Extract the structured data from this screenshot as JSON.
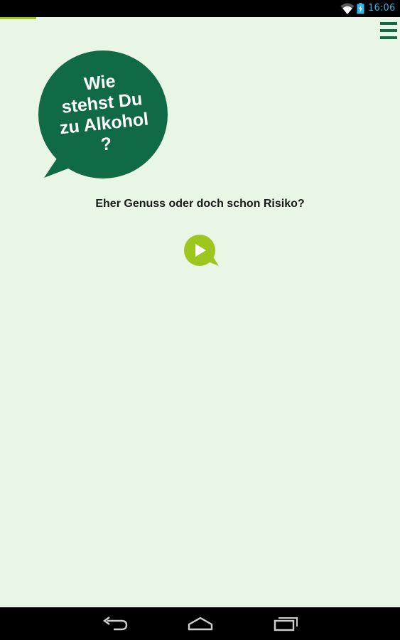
{
  "status_bar": {
    "time": "16:06",
    "icons": [
      "wifi-icon",
      "battery-charging-icon"
    ]
  },
  "progress": {
    "fraction": 0.09,
    "color": "#9dc61f"
  },
  "header": {
    "menu_icon": "hamburger-menu-icon"
  },
  "title_bubble": {
    "lines": [
      "Wie",
      "stehst Du",
      "zu Alkohol",
      "?"
    ],
    "color": "#0f6a45"
  },
  "subtitle": "Eher Genuss oder doch schon Risiko?",
  "play_button": {
    "icon": "play-icon",
    "color": "#9dc61f"
  },
  "nav_bar": {
    "icons": [
      "back-icon",
      "home-icon",
      "recent-apps-icon"
    ]
  },
  "colors": {
    "background": "#e9f5e5",
    "primary_green": "#0f6a45",
    "accent_green": "#9dc61f",
    "status_time": "#33b5e5"
  }
}
